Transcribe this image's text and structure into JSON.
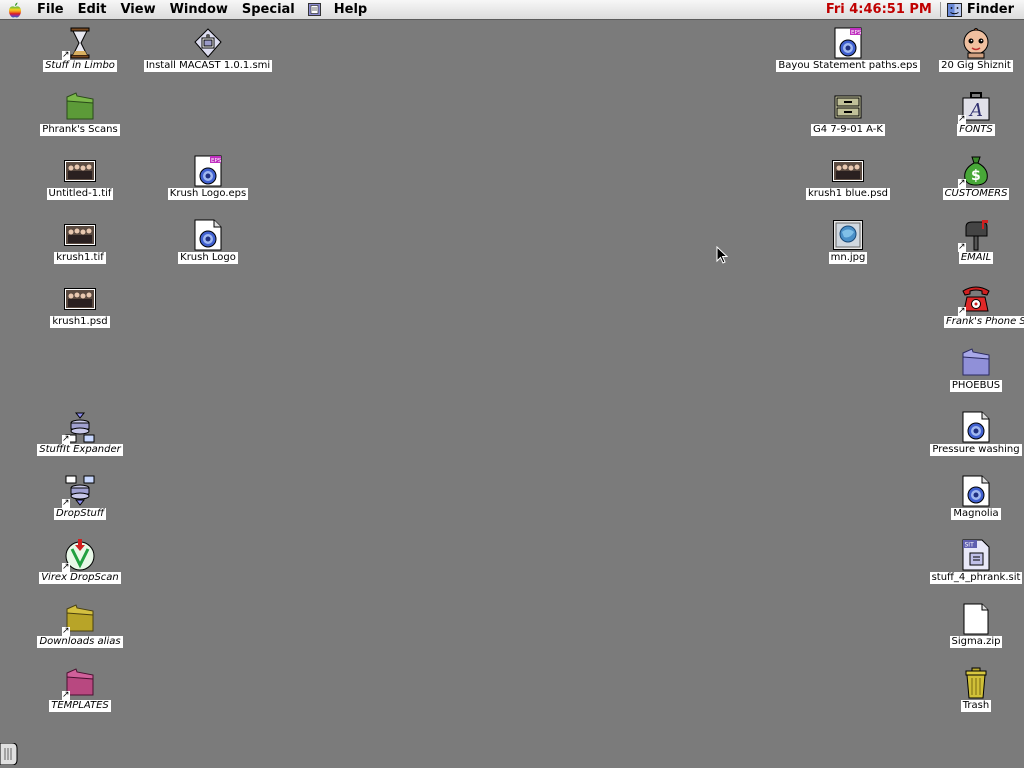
{
  "menubar": {
    "apple_icon": "apple-icon",
    "items": [
      "File",
      "Edit",
      "View",
      "Window",
      "Special",
      "Help"
    ],
    "clock": "Fri 4:46:51 PM",
    "app_name": "Finder"
  },
  "desktop_icons": {
    "left": [
      {
        "label": "Stuff in Limbo",
        "icon": "hourglass-icon",
        "alias": true
      },
      {
        "label": "Install MACAST 1.0.1.smi",
        "icon": "installer-icon",
        "alias": false
      },
      {
        "label": "Phrank's Scans",
        "icon": "green-folder-icon",
        "alias": false
      },
      {
        "label": "Untitled-1.tif",
        "icon": "image-thumbnail-icon",
        "alias": false
      },
      {
        "label": "Krush Logo.eps",
        "icon": "eps-document-icon",
        "alias": false
      },
      {
        "label": "krush1.tif",
        "icon": "image-thumbnail-icon",
        "alias": false
      },
      {
        "label": "Krush Logo",
        "icon": "document-icon",
        "alias": false
      },
      {
        "label": "krush1.psd",
        "icon": "image-thumbnail-icon",
        "alias": false
      },
      {
        "label": "StuffIt Expander",
        "icon": "stuffit-expander-icon",
        "alias": true
      },
      {
        "label": "DropStuff",
        "icon": "dropstuff-icon",
        "alias": true
      },
      {
        "label": "Virex DropScan",
        "icon": "virex-icon",
        "alias": true
      },
      {
        "label": "Downloads alias",
        "icon": "yellow-folder-icon",
        "alias": true
      },
      {
        "label": "TEMPLATES",
        "icon": "pink-folder-icon",
        "alias": true
      }
    ],
    "right": [
      {
        "label": "Bayou Statement paths.eps",
        "icon": "eps-document-icon",
        "alias": false
      },
      {
        "label": "20 Gig Shiznit",
        "icon": "kewpie-drive-icon",
        "alias": false
      },
      {
        "label": "G4 7-9-01 A-K",
        "icon": "file-cabinet-icon",
        "alias": false
      },
      {
        "label": "FONTS",
        "icon": "fonts-suitcase-icon",
        "alias": true
      },
      {
        "label": "krush1 blue.psd",
        "icon": "image-thumbnail-icon",
        "alias": false
      },
      {
        "label": "CUSTOMERS",
        "icon": "money-bag-icon",
        "alias": true
      },
      {
        "label": "mn.jpg",
        "icon": "jpeg-icon",
        "alias": false
      },
      {
        "label": "EMAIL",
        "icon": "mailbox-icon",
        "alias": true
      },
      {
        "label": "Frank's Phone Sheet",
        "icon": "telephone-icon",
        "alias": true
      },
      {
        "label": "PHOEBUS",
        "icon": "purple-folder-icon",
        "alias": false
      },
      {
        "label": "Pressure washing",
        "icon": "document-icon",
        "alias": false
      },
      {
        "label": "Magnolia",
        "icon": "document-icon",
        "alias": false
      },
      {
        "label": "stuff_4_phrank.sit",
        "icon": "sit-archive-icon",
        "alias": false
      },
      {
        "label": "Sigma.zip",
        "icon": "blank-document-icon",
        "alias": false
      },
      {
        "label": "Trash",
        "icon": "trash-icon",
        "alias": false
      }
    ]
  },
  "colors": {
    "desktop": "#7b7b7b",
    "clock": "#c00000"
  }
}
